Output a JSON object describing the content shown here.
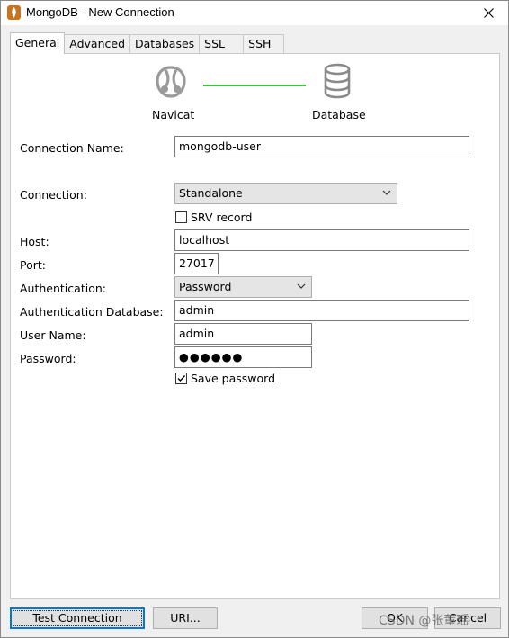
{
  "window": {
    "title": "MongoDB - New Connection"
  },
  "tabs": [
    {
      "label": "General",
      "active": true
    },
    {
      "label": "Advanced",
      "active": false
    },
    {
      "label": "Databases",
      "active": false
    },
    {
      "label": "SSL",
      "active": false
    },
    {
      "label": "SSH",
      "active": false
    }
  ],
  "graphic": {
    "left_label": "Navicat",
    "right_label": "Database",
    "left_icon": "navicat-logo-icon",
    "right_icon": "database-icon",
    "line_color": "#3fc13f"
  },
  "form": {
    "connection_name_label": "Connection Name:",
    "connection_name_value": "mongodb-user",
    "connection_label": "Connection:",
    "connection_value": "Standalone",
    "srv_label": "SRV record",
    "srv_checked": false,
    "host_label": "Host:",
    "host_value": "localhost",
    "port_label": "Port:",
    "port_value": "27017",
    "auth_label": "Authentication:",
    "auth_value": "Password",
    "auth_db_label": "Authentication Database:",
    "auth_db_value": "admin",
    "username_label": "User Name:",
    "username_value": "admin",
    "password_label": "Password:",
    "password_value": "●●●●●●",
    "save_password_label": "Save password",
    "save_password_checked": true
  },
  "buttons": {
    "test_connection": "Test Connection",
    "uri": "URI...",
    "ok": "OK",
    "cancel": "Cancel"
  },
  "watermark": "CSDN @张董瑶"
}
